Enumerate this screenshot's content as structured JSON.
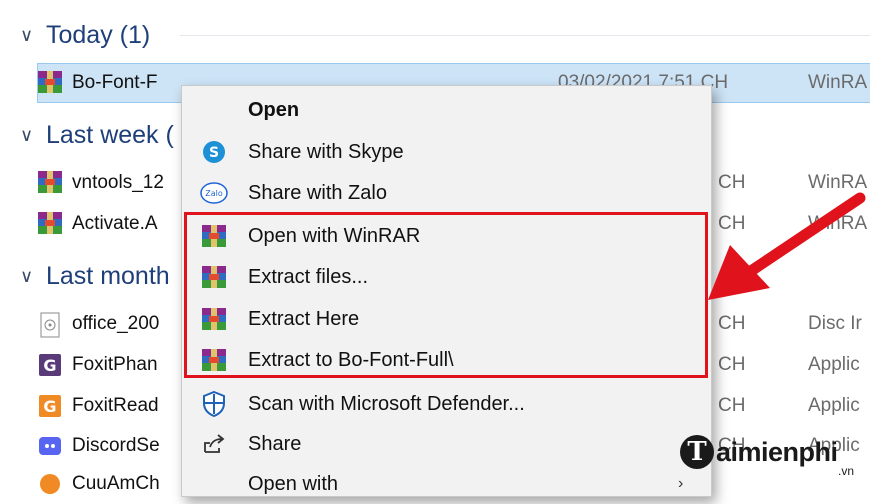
{
  "groups": {
    "today": "Today (1)",
    "last_week": "Last week (",
    "last_month": "Last month"
  },
  "files": [
    {
      "name": "Bo-Font-F",
      "date": "03/02/2021 7:51 CH",
      "type": "WinRA"
    },
    {
      "name": "vntools_12",
      "date": "CH",
      "type": "WinRA"
    },
    {
      "name": "Activate.A",
      "date": "CH",
      "type": "WinRA"
    },
    {
      "name": "office_200",
      "date": "CH",
      "type": "Disc Ir"
    },
    {
      "name": "FoxitPhan",
      "date": "CH",
      "type": "Applic"
    },
    {
      "name": "FoxitRead",
      "date": "CH",
      "type": "Applic"
    },
    {
      "name": "DiscordSe",
      "date": "CH",
      "type": "Applic"
    },
    {
      "name": "CuuAmCh",
      "date": "",
      "type": ""
    }
  ],
  "menu": [
    {
      "label": "Open",
      "icon": "none"
    },
    {
      "label": "Share with Skype",
      "icon": "skype-icon"
    },
    {
      "label": "Share with Zalo",
      "icon": "zalo-icon"
    },
    {
      "label": "Open with WinRAR",
      "icon": "winrar-icon"
    },
    {
      "label": "Extract files...",
      "icon": "winrar-icon"
    },
    {
      "label": "Extract Here",
      "icon": "winrar-icon"
    },
    {
      "label": "Extract to Bo-Font-Full\\",
      "icon": "winrar-icon"
    },
    {
      "label": "Scan with Microsoft Defender...",
      "icon": "defender-shield-icon"
    },
    {
      "label": "Share",
      "icon": "share-icon"
    },
    {
      "label": "Open with",
      "icon": "none"
    }
  ],
  "watermark": {
    "circle": "T",
    "text": "aimienphi",
    "suffix": ".vn"
  },
  "colors": {
    "highlight": "#e0131d",
    "selected_row": "#cde4f7"
  }
}
